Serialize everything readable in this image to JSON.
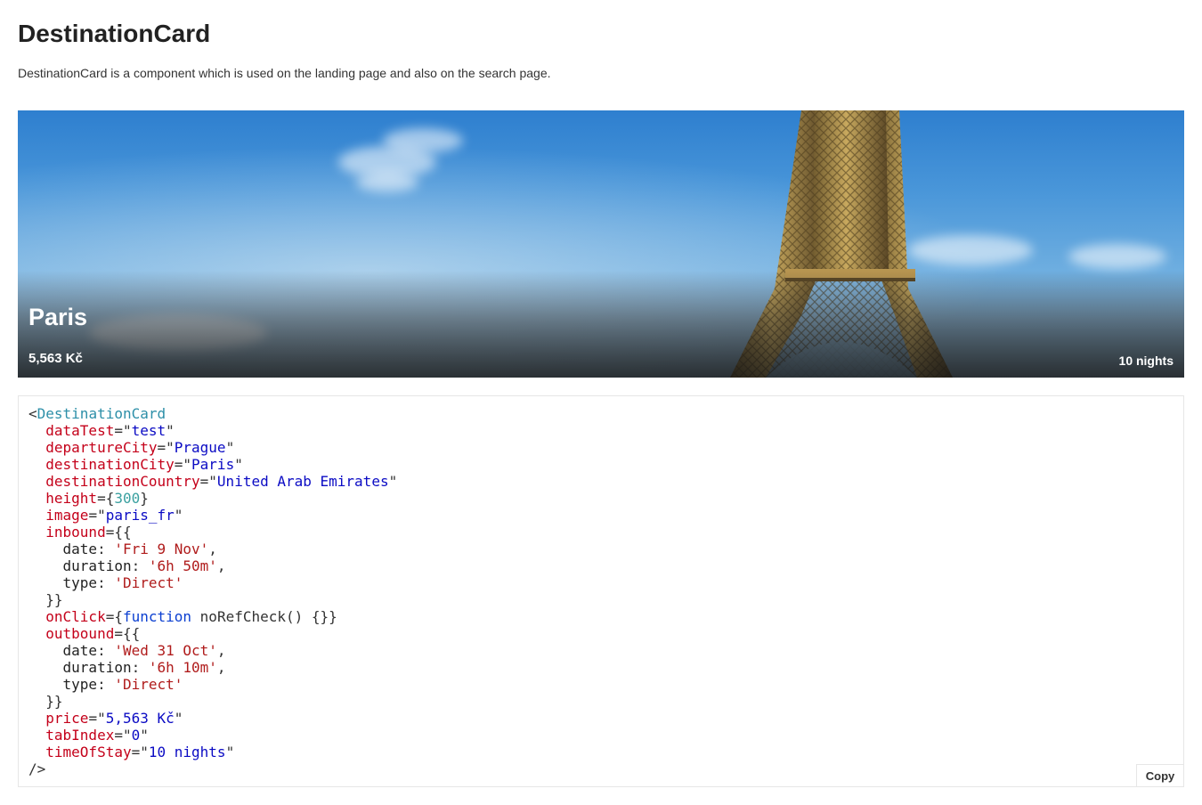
{
  "page": {
    "title": "DestinationCard",
    "description": "DestinationCard is a component which is used on the landing page and also on the search page."
  },
  "card": {
    "city": "Paris",
    "price": "5,563 Kč",
    "time_of_stay": "10 nights",
    "image_subject": "eiffel-tower"
  },
  "code": {
    "component": "DestinationCard",
    "props": [
      {
        "name": "dataTest",
        "type": "string",
        "value": "test"
      },
      {
        "name": "departureCity",
        "type": "string",
        "value": "Prague"
      },
      {
        "name": "destinationCity",
        "type": "string",
        "value": "Paris"
      },
      {
        "name": "destinationCountry",
        "type": "string",
        "value": "United Arab Emirates"
      },
      {
        "name": "height",
        "type": "number",
        "value": "300"
      },
      {
        "name": "image",
        "type": "string",
        "value": "paris_fr"
      },
      {
        "name": "inbound",
        "type": "object",
        "fields": [
          {
            "key": "date",
            "value": "'Fri 9 Nov'"
          },
          {
            "key": "duration",
            "value": "'6h 50m'"
          },
          {
            "key": "type",
            "value": "'Direct'"
          }
        ]
      },
      {
        "name": "onClick",
        "type": "function",
        "keyword": "function",
        "value": "noRefCheck() {}"
      },
      {
        "name": "outbound",
        "type": "object",
        "fields": [
          {
            "key": "date",
            "value": "'Wed 31 Oct'"
          },
          {
            "key": "duration",
            "value": "'6h 10m'"
          },
          {
            "key": "type",
            "value": "'Direct'"
          }
        ]
      },
      {
        "name": "price",
        "type": "string",
        "value": "5,563 Kč"
      },
      {
        "name": "tabIndex",
        "type": "string",
        "value": "0"
      },
      {
        "name": "timeOfStay",
        "type": "string",
        "value": "10 nights"
      }
    ],
    "copy_label": "Copy"
  },
  "colors": {
    "tag": "#2d8fa8",
    "attribute": "#c4011a",
    "string": "#0b0bc4",
    "number": "#3aa0a0",
    "object_value": "#b01c1c",
    "keyword": "#0b3fd1"
  }
}
